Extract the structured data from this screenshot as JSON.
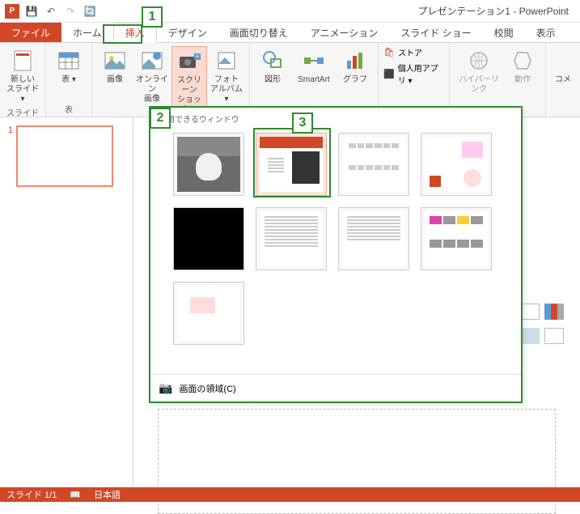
{
  "title": "プレゼンテーション1 - PowerPoint",
  "tabs": {
    "file": "ファイル",
    "home": "ホーム",
    "insert": "挿入",
    "design": "デザイン",
    "transitions": "画面切り替え",
    "animations": "アニメーション",
    "slideshow": "スライド ショー",
    "review": "校閲",
    "view": "表示"
  },
  "ribbon": {
    "slide_group": "スライド",
    "new_slide": "新しい\nスライド ▾",
    "table_group": "表",
    "table": "表 ▾",
    "image_group": "画像",
    "image": "画像",
    "online_image": "オンライン\n画像",
    "screenshot": "スクリーン\nショット ▾",
    "album": "フォト\nアルバム ▾",
    "shapes": "図形",
    "smartart": "SmartArt",
    "chart": "グラフ",
    "store": "ストア",
    "addins": "個人用アプリ ▾",
    "hyperlink": "ハイパーリンク",
    "action": "動作",
    "comment": "コメ"
  },
  "dropdown": {
    "header": "使用できるウィンドウ",
    "screen_clipping": "画面の領域(C)"
  },
  "status": {
    "slide": "スライド 1/1",
    "lang": "日本語"
  },
  "callouts": {
    "c1": "1",
    "c2": "2",
    "c3": "3"
  },
  "slide_num": "1"
}
